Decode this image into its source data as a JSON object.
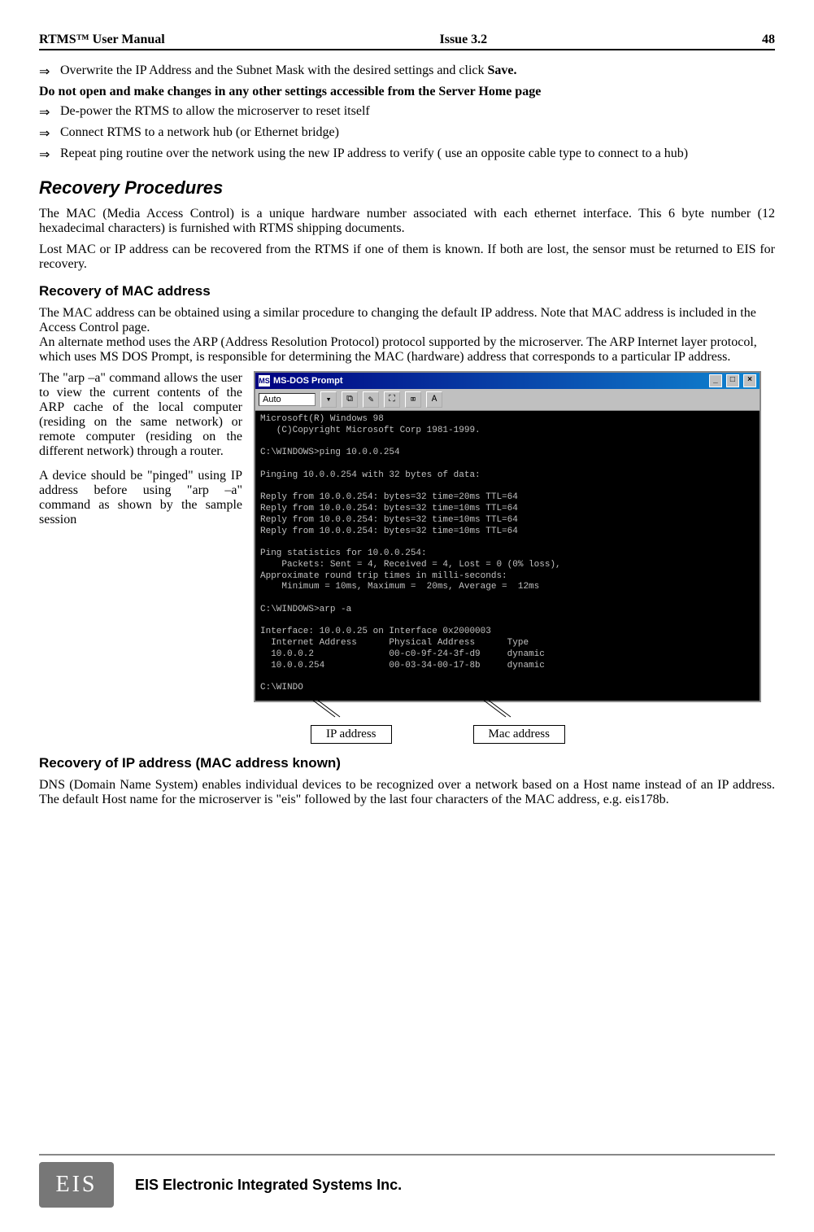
{
  "header": {
    "left": "RTMS™ User Manual",
    "center": "Issue 3.2",
    "right": "48"
  },
  "bullets_top": [
    {
      "prefix": "Overwrite the IP Address and the Subnet Mask with the desired settings and click ",
      "bold_suffix": "Save."
    }
  ],
  "bold_warning": "Do not open and make changes in any other settings accessible from the Server Home page",
  "bullets_after": [
    "De-power the RTMS to allow the microserver  to reset itself",
    "Connect RTMS to a network hub (or Ethernet bridge)",
    "Repeat ping routine over the network using the new IP address to verify ( use an opposite cable type to connect to a hub)"
  ],
  "section_recovery": "Recovery Procedures",
  "para_mac": "The MAC (Media Access Control) is a unique hardware number associated with each ethernet interface. This 6 byte number (12 hexadecimal characters) is furnished with RTMS shipping documents.",
  "para_lost": "Lost MAC or IP address can be recovered from the RTMS if one of them is known.  If both are lost, the sensor must be returned to EIS for recovery.",
  "sub_mac": "Recovery of MAC address",
  "para_mac_sub": "The MAC address can be obtained using a similar procedure to changing the default IP address. Note that MAC address is included in the Access Control page.\nAn alternate method uses the ARP (Address Resolution Protocol) protocol supported by the microserver.  The ARP Internet layer protocol, which uses MS DOS Prompt, is responsible for determining the MAC (hardware) address that corresponds to a particular IP address.",
  "leftcol": {
    "p1": "The \"arp –a\" command allows the user to view the current contents of the ARP cache of the local computer (residing on the same network) or remote computer (residing on the different network) through a router.",
    "p2": "A device should be \"pinged\" using IP address before using \"arp –a\" command as shown by the sample session"
  },
  "dos": {
    "title": "MS-DOS Prompt",
    "toolbar_sel": "Auto",
    "screen": "Microsoft(R) Windows 98\n   (C)Copyright Microsoft Corp 1981-1999.\n\nC:\\WINDOWS>ping 10.0.0.254\n\nPinging 10.0.0.254 with 32 bytes of data:\n\nReply from 10.0.0.254: bytes=32 time=20ms TTL=64\nReply from 10.0.0.254: bytes=32 time=10ms TTL=64\nReply from 10.0.0.254: bytes=32 time=10ms TTL=64\nReply from 10.0.0.254: bytes=32 time=10ms TTL=64\n\nPing statistics for 10.0.0.254:\n    Packets: Sent = 4, Received = 4, Lost = 0 (0% loss),\nApproximate round trip times in milli-seconds:\n    Minimum = 10ms, Maximum =  20ms, Average =  12ms\n\nC:\\WINDOWS>arp -a\n\nInterface: 10.0.0.25 on Interface 0x2000003\n  Internet Address      Physical Address      Type\n  10.0.0.2              00-c0-9f-24-3f-d9     dynamic\n  10.0.0.254            00-03-34-00-17-8b     dynamic\n\nC:\\WINDO"
  },
  "callouts": {
    "ip": "IP address",
    "mac": "Mac address"
  },
  "sub_ip": "Recovery of IP address (MAC address known)",
  "para_ip": "DNS (Domain Name System) enables individual devices to be recognized over a network based on a Host name instead of an IP address. The default Host name for the microserver is \"eis\" followed by the last four characters of the MAC address, e.g. eis178b.",
  "footer": {
    "logo": "EIS",
    "text": "EIS Electronic Integrated Systems Inc."
  },
  "glyphs": {
    "arrow": "⇒"
  }
}
